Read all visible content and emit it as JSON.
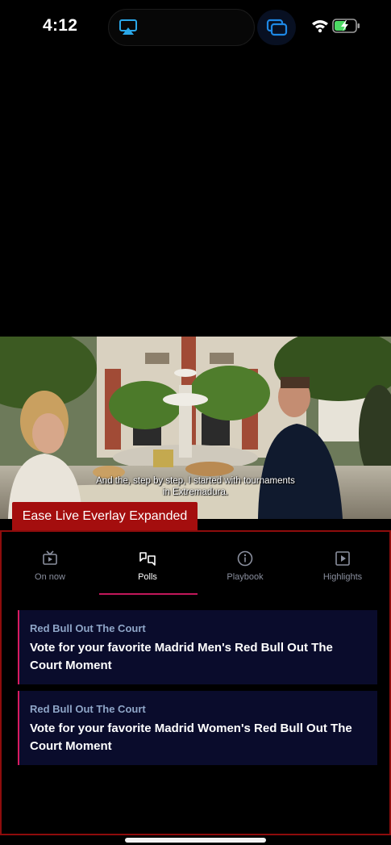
{
  "status_bar": {
    "time": "4:12",
    "icons": [
      "airplay-icon",
      "screen-mirroring-icon",
      "wifi-icon",
      "battery-charging-icon"
    ],
    "accent": "#1e88e5"
  },
  "video": {
    "subtitle_line1": "And the, step by step, I started with tournaments",
    "subtitle_line2": "in Extremadura."
  },
  "overlay_label": "Ease Live Everlay Expanded",
  "tabs": [
    {
      "label": "On now",
      "icon": "tv-icon",
      "active": false
    },
    {
      "label": "Polls",
      "icon": "poll-chat-icon",
      "active": true
    },
    {
      "label": "Playbook",
      "icon": "info-icon",
      "active": false
    },
    {
      "label": "Highlights",
      "icon": "play-icon",
      "active": false
    }
  ],
  "polls": [
    {
      "kicker": "Red Bull Out The Court",
      "title": "Vote for your favorite Madrid Men's Red Bull Out The Court Moment"
    },
    {
      "kicker": "Red Bull Out The Court",
      "title": "Vote for your favorite Madrid Women's Red Bull Out The Court Moment"
    }
  ],
  "colors": {
    "accent_pink": "#d81b60",
    "overlay_red": "#a40e0e",
    "card_bg": "#0a0c2c"
  }
}
